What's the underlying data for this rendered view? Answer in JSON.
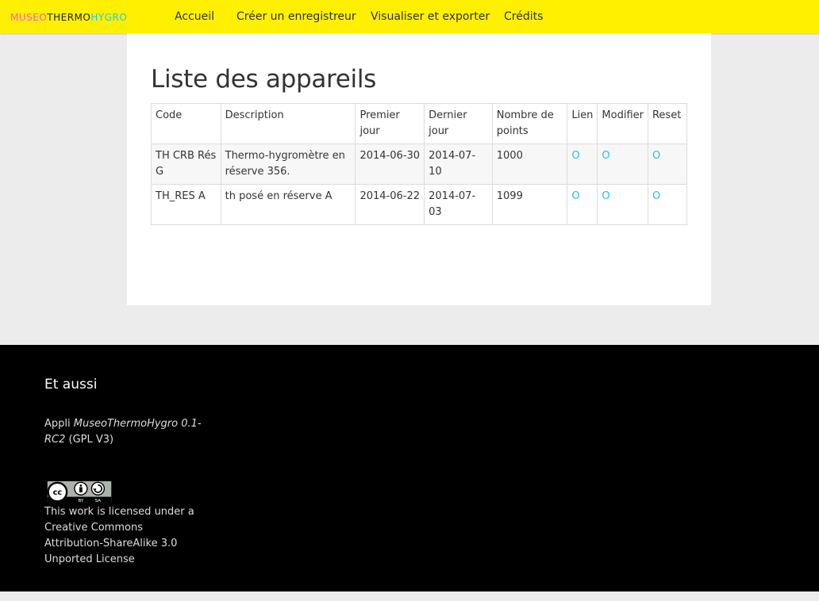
{
  "navbar": {
    "brand": {
      "part1": "MUSEO",
      "part2": "THERMO",
      "part3": "HYGRO"
    },
    "items": [
      {
        "label": "Accueil"
      },
      {
        "label": "Créer un enregistreur"
      },
      {
        "label": "Visualiser et exporter"
      },
      {
        "label": "Crédits"
      }
    ],
    "background_color": "#fff000"
  },
  "main": {
    "title": "Liste des appareils",
    "table": {
      "columns": [
        "Code",
        "Description",
        "Premier jour",
        "Dernier jour",
        "Nombre de points",
        "Lien",
        "Modifier",
        "Reset"
      ],
      "rows": [
        {
          "code": "TH CRB Rés G",
          "description": "Thermo-hygromètre en réserve 356.",
          "first_day": "2014-06-30",
          "last_day": "2014-07-10",
          "points": "1000",
          "link": "O",
          "edit": "O",
          "reset": "O"
        },
        {
          "code": "TH_RES A",
          "description": "th posé en réserve A",
          "first_day": "2014-06-22",
          "last_day": "2014-07-03",
          "points": "1099",
          "link": "O",
          "edit": "O",
          "reset": "O"
        }
      ]
    },
    "action_color": "#22c0e8"
  },
  "footer": {
    "title": "Et aussi",
    "app_prefix": "Appli ",
    "app_name": "MuseoThermoHygro 0.1-RC2",
    "app_suffix": " (GPL V3)",
    "cc_badge": {
      "by": "BY",
      "sa": "SA"
    },
    "license_text": "This work is licensed under a Creative Commons Attribution-ShareAlike 3.0 Unported License",
    "background_color": "#000000"
  }
}
